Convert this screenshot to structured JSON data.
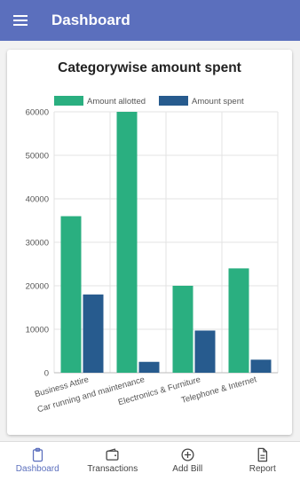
{
  "app": {
    "title": "Dashboard"
  },
  "icons": {
    "menu": "menu-icon"
  },
  "colors": {
    "primary": "#5b6fbd",
    "allotted": "#2aaf80",
    "spent": "#275b8e"
  },
  "chart_data": {
    "type": "bar",
    "title": "Categorywise amount spent",
    "categories": [
      "Business Attire",
      "Car running and maintenance",
      "Electronics & Furniture",
      "Telephone & Internet"
    ],
    "series": [
      {
        "name": "Amount allotted",
        "values": [
          36000,
          60000,
          20000,
          24000
        ]
      },
      {
        "name": "Amount spent",
        "values": [
          18000,
          2500,
          9700,
          3000
        ]
      }
    ],
    "ylim": [
      0,
      60000
    ],
    "yticks": [
      0,
      10000,
      20000,
      30000,
      40000,
      50000,
      60000
    ],
    "grid": true,
    "legend": "top"
  },
  "nav": [
    {
      "label": "Dashboard",
      "icon": "clipboard-icon",
      "active": true
    },
    {
      "label": "Transactions",
      "icon": "wallet-icon",
      "active": false
    },
    {
      "label": "Add Bill",
      "icon": "add-circle-icon",
      "active": false
    },
    {
      "label": "Report",
      "icon": "document-icon",
      "active": false
    }
  ]
}
